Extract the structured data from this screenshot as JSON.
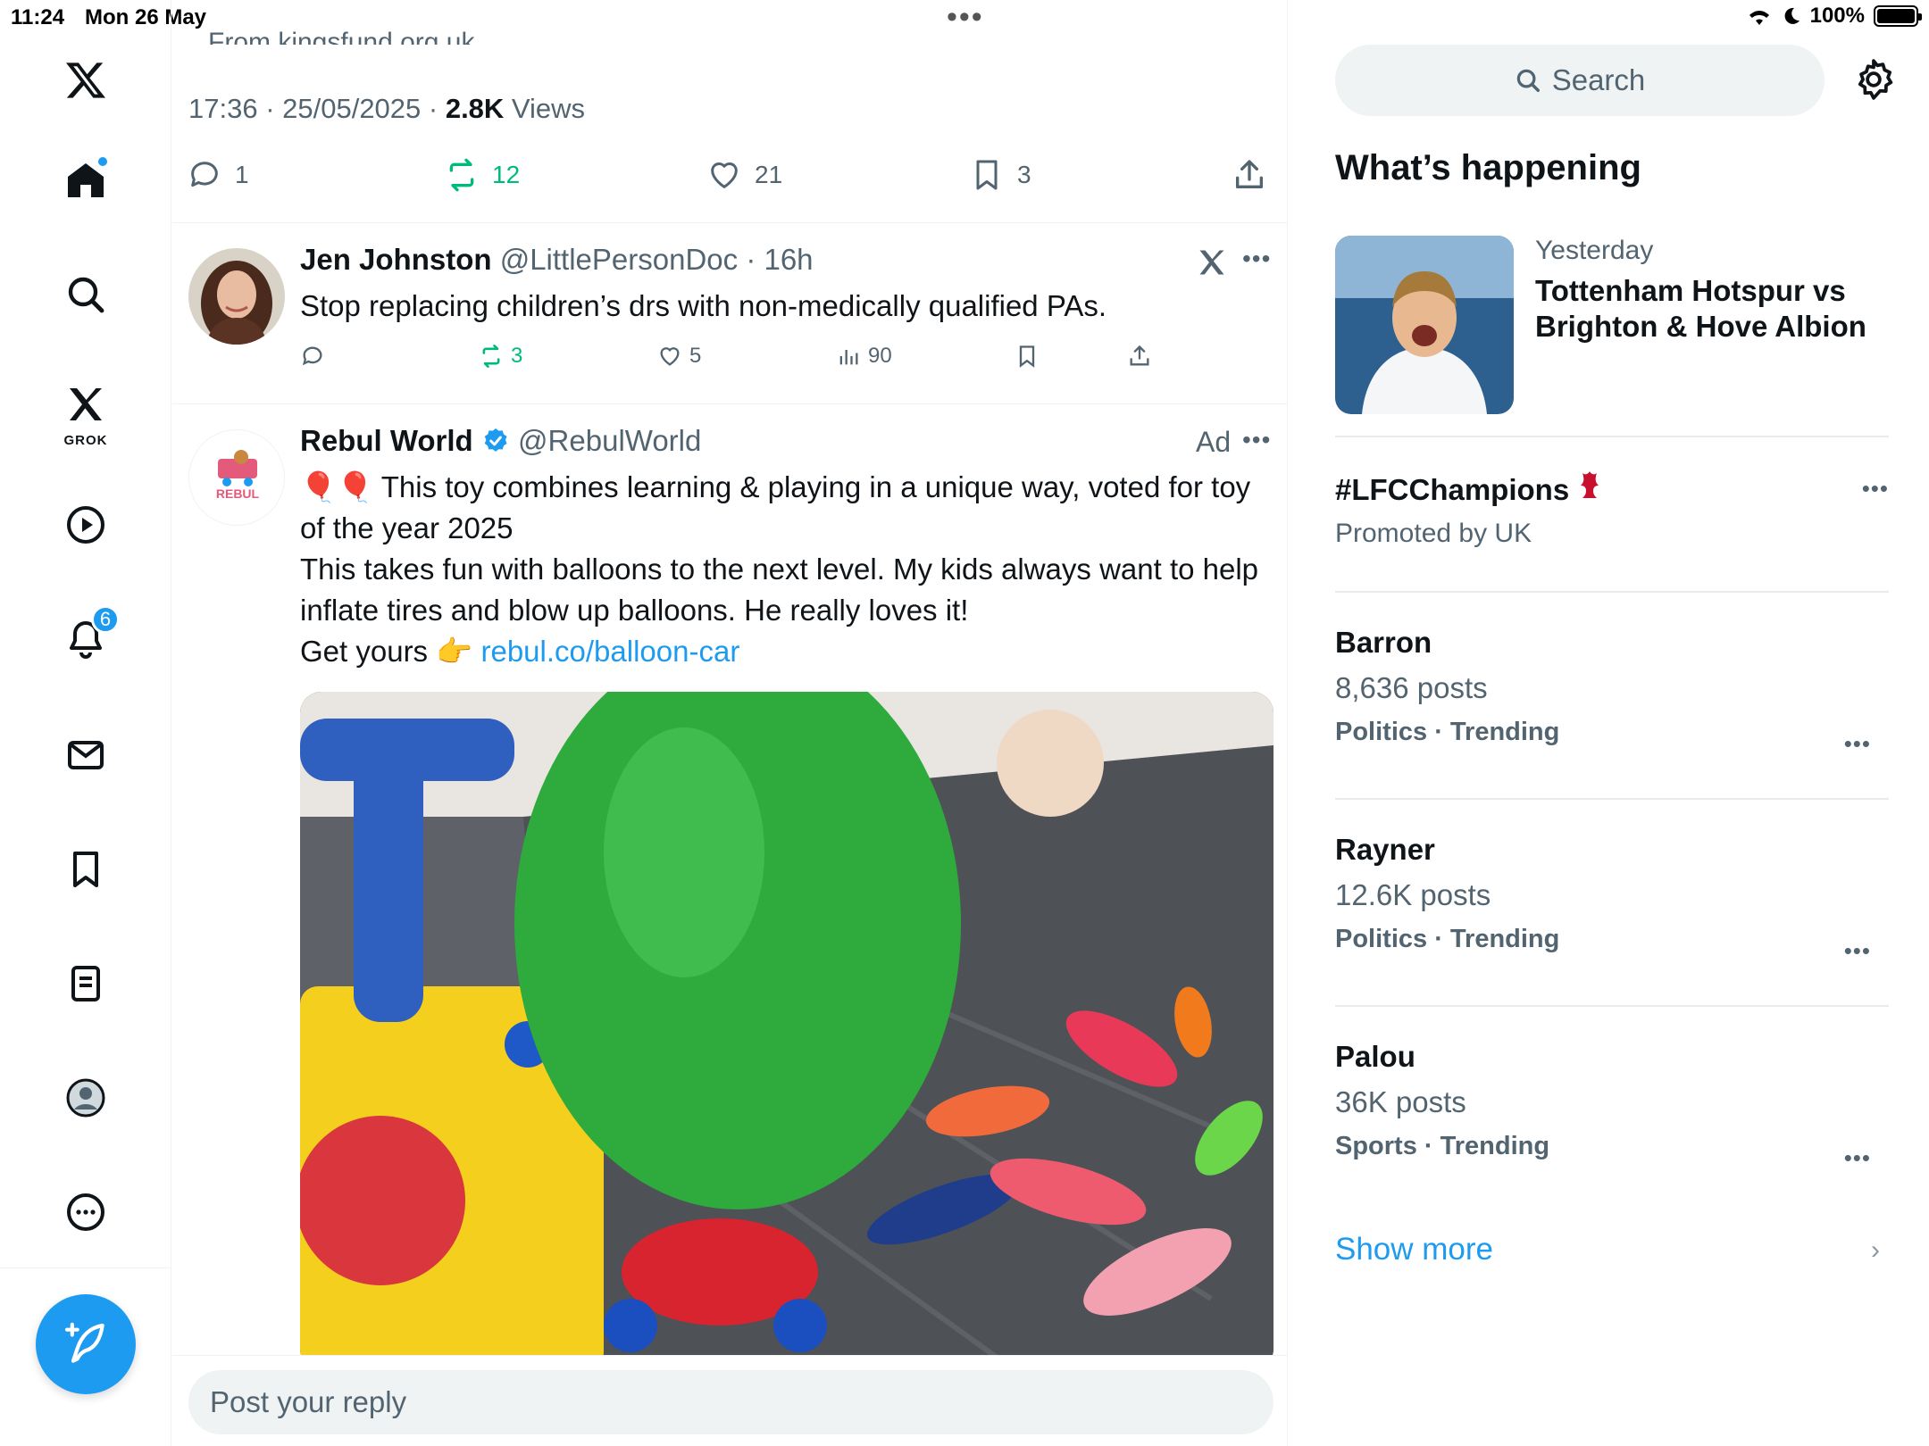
{
  "status": {
    "time": "11:24",
    "date": "Mon 26 May",
    "battery": "100%"
  },
  "nav": {
    "items": [
      "x-logo",
      "home",
      "explore",
      "grok",
      "video",
      "notifications",
      "messages",
      "bookmarks",
      "lists",
      "profile",
      "more"
    ],
    "grok_label": "GROK",
    "notification_count": "6"
  },
  "focused_tweet": {
    "clipped_text": "From kingsfund.org.uk",
    "time": "17:36 · 25/05/2025 · ",
    "views_count": "2.8K",
    "views_label": " Views",
    "replies": "1",
    "reposts": "12",
    "likes": "21",
    "bookmarks": "3"
  },
  "reply_tweet": {
    "name": "Jen Johnston",
    "handle": " @LittlePersonDoc · 16h",
    "text": "Stop replacing children’s drs with non-medically qualified PAs.",
    "reposts": "3",
    "likes": "5",
    "views": "90"
  },
  "ad_tweet": {
    "name": "Rebul World",
    "handle": " @RebulWorld",
    "ad_label": "Ad",
    "line1": "🎈🎈 This toy combines learning & playing in a unique way, voted for toy of the year 2025",
    "line2": "This takes fun with balloons to the next level. My kids always want to help inflate tires and blow up balloons. He really loves it!",
    "line3_prefix": "Get yours 👉 ",
    "link": "rebul.co/balloon-car",
    "avatar_text": "REBUL"
  },
  "reply_placeholder": "Post your reply",
  "sidebar": {
    "search_label": "Search",
    "title": "What’s happening",
    "feature": {
      "sub": "Yesterday",
      "title": "Tottenham Hotspur vs Brighton & Hove Albion"
    },
    "promoted": {
      "title": "#LFCChampions",
      "sub": "Promoted by UK"
    },
    "trends": [
      {
        "title": "Barron",
        "posts": "8,636 posts",
        "category": "Politics · Trending"
      },
      {
        "title": "Rayner",
        "posts": "12.6K posts",
        "category": "Politics · Trending"
      },
      {
        "title": "Palou",
        "posts": "36K posts",
        "category": "Sports · Trending"
      }
    ],
    "show_more": "Show more"
  },
  "colors": {
    "accent": "#1d9bf0",
    "repost_green": "#00ba7c",
    "muted": "#536471"
  }
}
